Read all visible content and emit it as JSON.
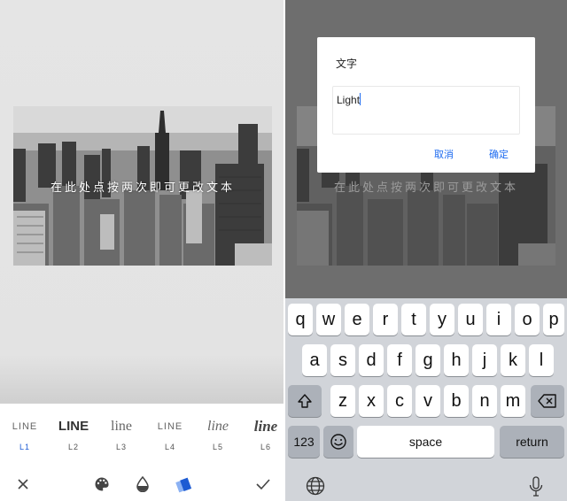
{
  "left": {
    "overlay_text": "在此处点按两次即可更改文本",
    "styles": [
      {
        "preview": "LINE",
        "code": "L1",
        "active": true
      },
      {
        "preview": "LINE",
        "code": "L2",
        "active": false
      },
      {
        "preview": "line",
        "code": "L3",
        "active": false
      },
      {
        "preview": "LINE",
        "code": "L4",
        "active": false
      },
      {
        "preview": "line",
        "code": "L5",
        "active": false
      },
      {
        "preview": "line",
        "code": "L6",
        "active": false
      }
    ],
    "toolbar_icons": [
      "close-icon",
      "palette-icon",
      "opacity-icon",
      "style-icon",
      "checkmark-icon"
    ]
  },
  "right": {
    "overlay_text": "在此处点按两次即可更改文本",
    "dialog": {
      "title": "文字",
      "input_value": "Light",
      "cancel_label": "取消",
      "confirm_label": "确定"
    },
    "keyboard": {
      "row1": [
        "q",
        "w",
        "e",
        "r",
        "t",
        "y",
        "u",
        "i",
        "o",
        "p"
      ],
      "row2": [
        "a",
        "s",
        "d",
        "f",
        "g",
        "h",
        "j",
        "k",
        "l"
      ],
      "row3": [
        "z",
        "x",
        "c",
        "v",
        "b",
        "n",
        "m"
      ],
      "numbers_label": "123",
      "space_label": "space",
      "return_label": "return"
    }
  },
  "colors": {
    "accent": "#1d5bd3",
    "dialog_button": "#1f6cf0",
    "dim_overlay": "#6e6e6e"
  }
}
